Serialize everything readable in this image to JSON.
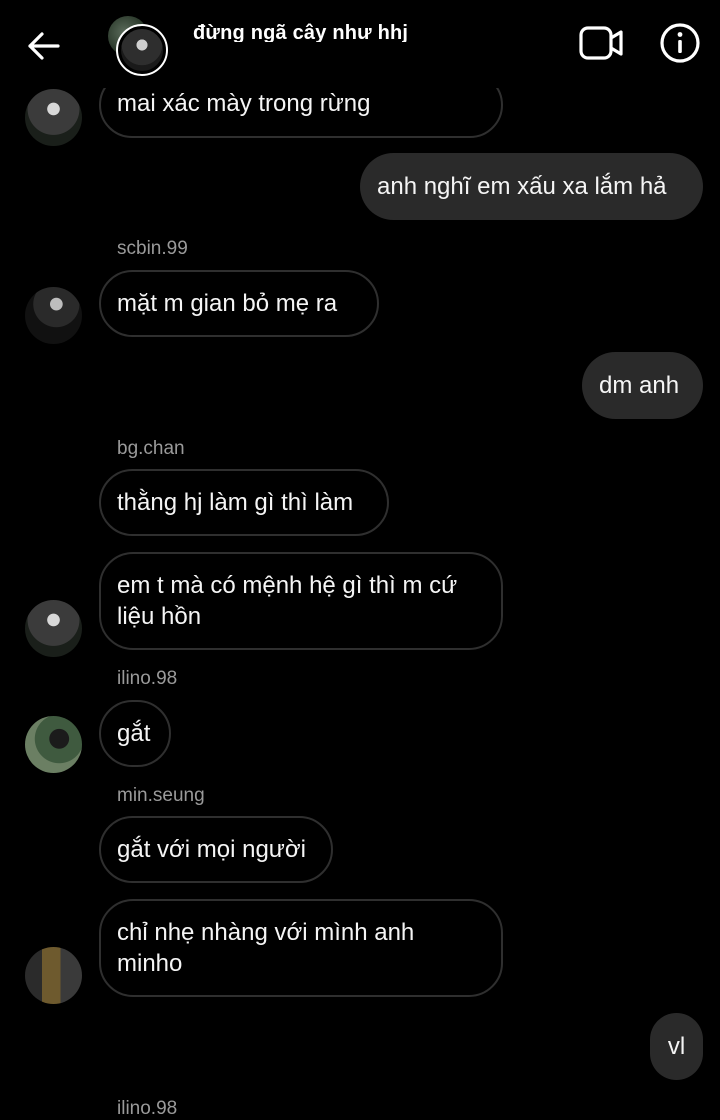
{
  "header": {
    "title": "đừng ngã cây như hhj",
    "back_icon": "arrow-left-icon",
    "video_icon": "video-call-icon",
    "info_icon": "info-icon"
  },
  "messages": [
    {
      "type": "incoming",
      "text": "mai xác mày trong rừng"
    },
    {
      "type": "outgoing",
      "text": "anh nghĩ em xấu xa lắm hả"
    },
    {
      "type": "sender",
      "text": "scbin.99"
    },
    {
      "type": "incoming",
      "text": "mặt m gian bỏ mẹ ra"
    },
    {
      "type": "outgoing",
      "text": "dm anh"
    },
    {
      "type": "sender",
      "text": "bg.chan"
    },
    {
      "type": "incoming",
      "text": "thằng hj làm gì thì làm"
    },
    {
      "type": "incoming",
      "text": "em t mà có mệnh hệ gì thì m cứ liệu hồn"
    },
    {
      "type": "sender",
      "text": "ilino.98"
    },
    {
      "type": "incoming",
      "text": "gắt"
    },
    {
      "type": "sender",
      "text": "min.seung"
    },
    {
      "type": "incoming",
      "text": "gắt với mọi người"
    },
    {
      "type": "incoming",
      "text": "chỉ nhẹ nhàng với mình anh minho"
    },
    {
      "type": "outgoing",
      "text": "vl"
    },
    {
      "type": "sender",
      "text": "ilino.98"
    }
  ],
  "colors": {
    "background": "#000000",
    "outgoing_bubble": "#2a2a2a",
    "incoming_border": "#2f2f2f",
    "sender_text": "#9a9a9a"
  }
}
